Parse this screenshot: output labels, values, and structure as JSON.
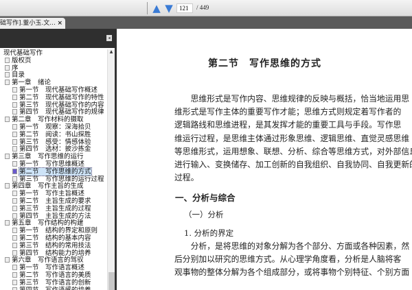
{
  "toolbar": {
    "page_current": "121",
    "page_total": "/ 449",
    "prev_icon": "arrow-up",
    "next_icon": "arrow-down"
  },
  "tab": {
    "title": "础写作].董小玉.文...",
    "close": "×"
  },
  "sidebar": {
    "collapse": "◂",
    "scroll_up": "▲",
    "tree": [
      {
        "label": "现代基础写作",
        "level": 0
      },
      {
        "label": "版权页",
        "level": 1
      },
      {
        "label": "序",
        "level": 1
      },
      {
        "label": "目录",
        "level": 1
      },
      {
        "label": "第一章　绪论",
        "level": 1
      },
      {
        "label": "第一节　现代基础写作概述",
        "level": 2
      },
      {
        "label": "第二节　现代基础写作的特性",
        "level": 2
      },
      {
        "label": "第三节　现代基础写作的内容",
        "level": 2
      },
      {
        "label": "第四节　现代基础写作的规律",
        "level": 2
      },
      {
        "label": "第二章　写作材料的摄取",
        "level": 1
      },
      {
        "label": "第一节　观察：深海拾贝",
        "level": 2
      },
      {
        "label": "第二节　阅读：书山探胜",
        "level": 2
      },
      {
        "label": "第三节　感受：情感体验",
        "level": 2
      },
      {
        "label": "第四节　选材：披沙拣金",
        "level": 2
      },
      {
        "label": "第三章　写作思维的运行",
        "level": 1
      },
      {
        "label": "第一节　写作思维概述",
        "level": 2
      },
      {
        "label": "第二节　写作思维的方式",
        "level": 2,
        "selected": true
      },
      {
        "label": "第三节　写作思维的运行过程",
        "level": 2
      },
      {
        "label": "第四章　写作主旨的生成",
        "level": 1
      },
      {
        "label": "第一节　写作主旨概述",
        "level": 2
      },
      {
        "label": "第二节　主旨生成的要求",
        "level": 2
      },
      {
        "label": "第三节　主旨生成的过程",
        "level": 2
      },
      {
        "label": "第四节　主旨生成的方法",
        "level": 2
      },
      {
        "label": "第五章　写作结构的构建",
        "level": 1
      },
      {
        "label": "第一节　结构的界定和原则",
        "level": 2
      },
      {
        "label": "第二节　结构的基本内容",
        "level": 2
      },
      {
        "label": "第三节　结构的常用技法",
        "level": 2
      },
      {
        "label": "第四节　结构能力的培养",
        "level": 2
      },
      {
        "label": "第六章　写作语言的驾驭",
        "level": 1
      },
      {
        "label": "第一节　写作语言概述",
        "level": 2
      },
      {
        "label": "第二节　写作语言的美质",
        "level": 2
      },
      {
        "label": "第三节　写作语言的创新",
        "level": 2
      },
      {
        "label": "第四节　写作语感的培养",
        "level": 2
      }
    ]
  },
  "document": {
    "title": "第二节　写作思维的方式",
    "para1": [
      "　　思维形式是写作内容、思维规律的反映与概括，恰当地运用思",
      "维形式是写作主体的重要写作才能；思维方式则规定着写作者的",
      "逻辑路线和思维进程，是其发挥才能的重要工具与手段。写作思",
      "维运行过程，是思维主体通过形象思维、逻辑思维、直觉灵感思维",
      "等思维形式，运用想象、联想、分析、综合等思维方式，对外部信息",
      "进行输入、变换储存、加工创新的自我组织、自我协同、自我更新的",
      "过程。"
    ],
    "heading1": "一、分析与综合",
    "heading2": "（一）分析",
    "heading3": "1. 分析的界定",
    "para2": [
      "　　分析，是将思维的对象分解为各个部分、方面或各种因素，然",
      "后分别加以研究的思维方式。从心理学角度看，分析是人脑将客",
      "观事物的整体分解为各个组成部分，或将事物个别特征、个别方面"
    ]
  }
}
